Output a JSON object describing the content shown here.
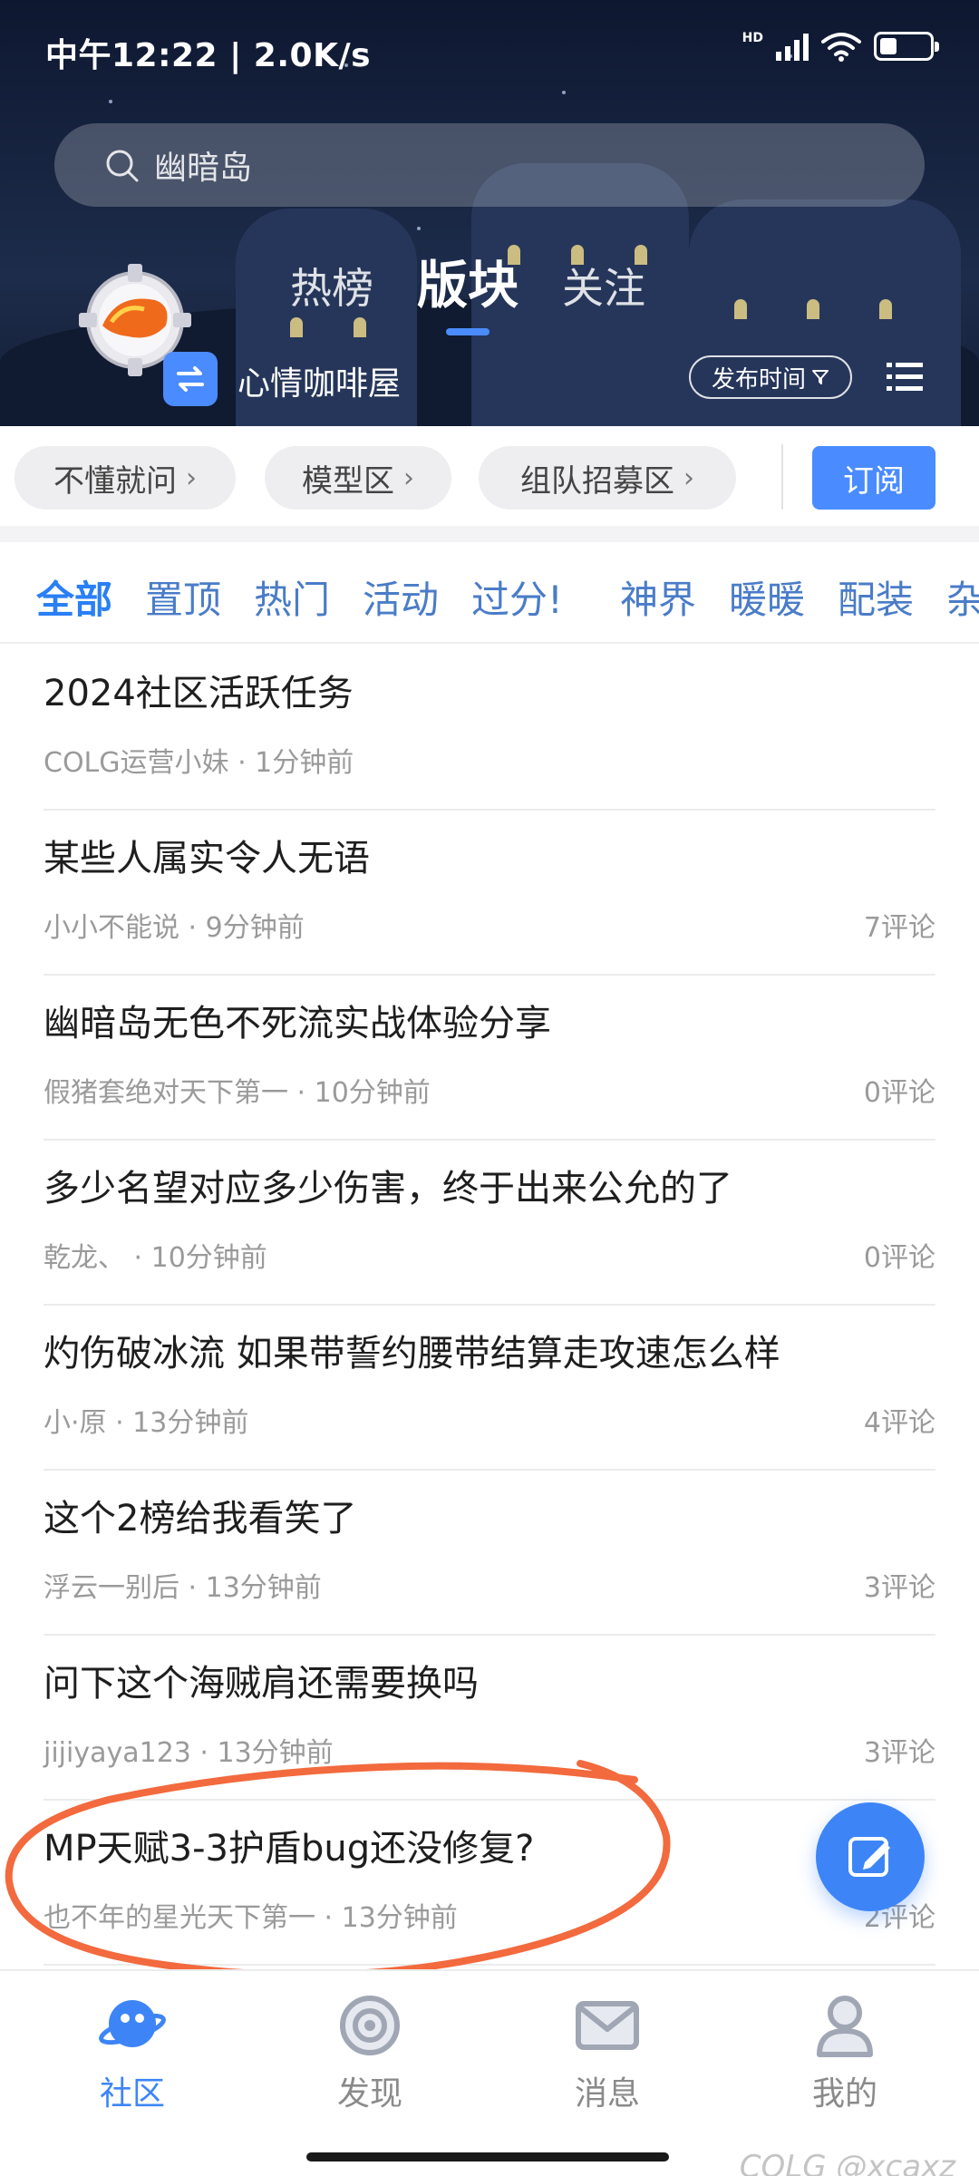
{
  "status_bar": {
    "time": "中午12:22 | 2.0K/s",
    "network": "HD"
  },
  "search": {
    "placeholder": "幽暗岛"
  },
  "top_tabs": [
    {
      "label": "热榜",
      "active": false
    },
    {
      "label": "版块",
      "active": true
    },
    {
      "label": "关注",
      "active": false
    }
  ],
  "board": {
    "name": "心情咖啡屋",
    "sort_label": "发布时间"
  },
  "chips": [
    "不懂就问",
    "模型区",
    "组队招募区"
  ],
  "subscribe_label": "订阅",
  "filters": [
    "全部",
    "置顶",
    "热门",
    "活动",
    "过分!",
    "神界",
    "暖暖",
    "配装",
    "杂"
  ],
  "posts": [
    {
      "title": "2024社区活跃任务",
      "author": "COLG运营小妹",
      "time": "1分钟前",
      "comments": ""
    },
    {
      "title": "某些人属实令人无语",
      "author": "小小不能说",
      "time": "9分钟前",
      "comments": "7评论"
    },
    {
      "title": "幽暗岛无色不死流实战体验分享",
      "author": "假猪套绝对天下第一",
      "time": "10分钟前",
      "comments": "0评论"
    },
    {
      "title": "多少名望对应多少伤害，终于出来公允的了",
      "author": "乾龙、",
      "time": "10分钟前",
      "comments": "0评论"
    },
    {
      "title": "灼伤破冰流 如果带誓约腰带结算走攻速怎么样",
      "author": "小·原",
      "time": "13分钟前",
      "comments": "4评论"
    },
    {
      "title": "这个2榜给我看笑了",
      "author": "浮云一别后",
      "time": "13分钟前",
      "comments": "3评论"
    },
    {
      "title": "问下这个海贼肩还需要换吗",
      "author": "jijiyaya123",
      "time": "13分钟前",
      "comments": "3评论"
    },
    {
      "title": "MP天赋3-3护盾bug还没修复?",
      "author": "也不年的星光天下第一",
      "time": "13分钟前",
      "comments": "2评论"
    }
  ],
  "bottom_nav": [
    {
      "label": "社区",
      "active": true
    },
    {
      "label": "发现",
      "active": false
    },
    {
      "label": "消息",
      "active": false
    },
    {
      "label": "我的",
      "active": false
    }
  ],
  "watermark": "COLG @xcaxz",
  "colors": {
    "accent": "#3d85f7",
    "annotation": "#f26a3d",
    "header_bg": "#16233f"
  }
}
